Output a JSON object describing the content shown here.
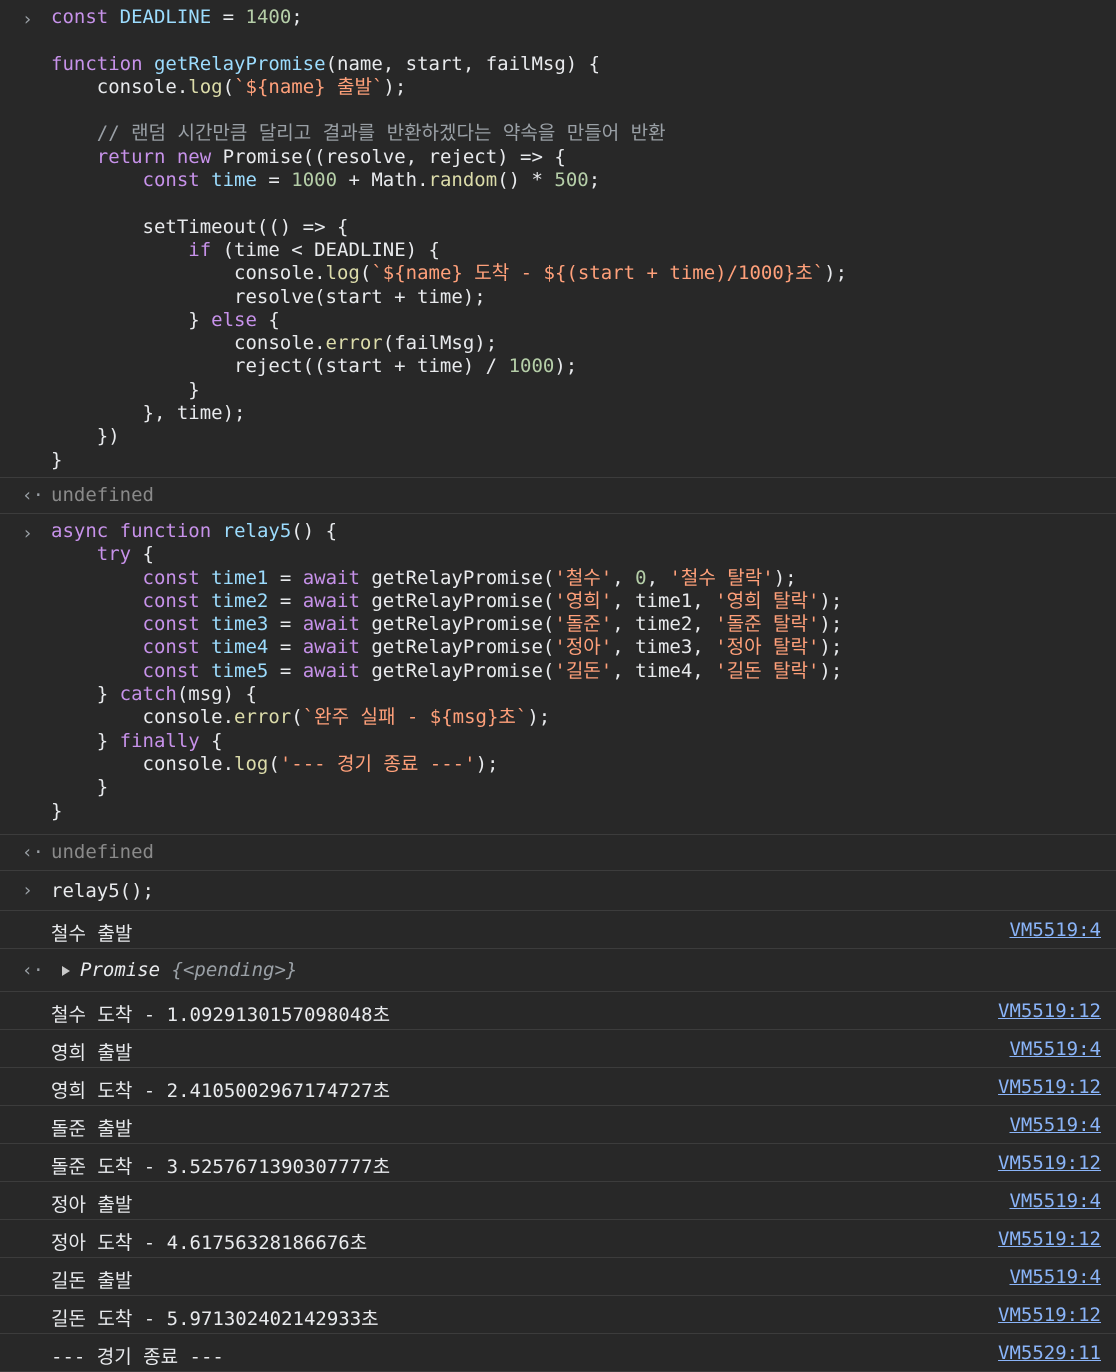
{
  "prompt_glyph": "›",
  "result_glyph": "‹·",
  "code_block_1": [
    "const DEADLINE = 1400;",
    "",
    "function getRelayPromise(name, start, failMsg) {",
    "    console.log(`${name} 출발`);",
    "",
    "    // 랜덤 시간만큼 달리고 결과를 반환하겠다는 약속을 만들어 반환",
    "    return new Promise((resolve, reject) => {",
    "        const time = 1000 + Math.random() * 500;",
    "",
    "        setTimeout(() => {",
    "            if (time < DEADLINE) {",
    "                console.log(`${name} 도착 - ${(start + time)/1000}초`);",
    "                resolve(start + time);",
    "            } else {",
    "                console.error(failMsg);",
    "                reject((start + time) / 1000);",
    "            }",
    "        }, time);",
    "    })",
    "}"
  ],
  "result_1": "undefined",
  "code_block_2": [
    "async function relay5() {",
    "    try {",
    "        const time1 = await getRelayPromise('철수', 0, '철수 탈락');",
    "        const time2 = await getRelayPromise('영희', time1, '영희 탈락');",
    "        const time3 = await getRelayPromise('돌준', time2, '돌준 탈락');",
    "        const time4 = await getRelayPromise('정아', time3, '정아 탈락');",
    "        const time5 = await getRelayPromise('길돈', time4, '길돈 탈락');",
    "    } catch(msg) {",
    "        console.error(`완주 실패 - ${msg}초`);",
    "    } finally {",
    "        console.log('--- 경기 종료 ---');",
    "    }",
    "}"
  ],
  "result_2": "undefined",
  "command_3": "relay5();",
  "first_log": {
    "text": "철수 출발",
    "source": "VM5519:4"
  },
  "promise_result": {
    "name": "Promise",
    "state": "{<pending>}"
  },
  "logs": [
    {
      "text": "철수 도착 - 1.0929130157098048초",
      "source": "VM5519:12"
    },
    {
      "text": "영희 출발",
      "source": "VM5519:4"
    },
    {
      "text": "영희 도착 - 2.4105002967174727초",
      "source": "VM5519:12"
    },
    {
      "text": "돌준 출발",
      "source": "VM5519:4"
    },
    {
      "text": "돌준 도착 - 3.5257671390307777초",
      "source": "VM5519:12"
    },
    {
      "text": "정아 출발",
      "source": "VM5519:4"
    },
    {
      "text": "정아 도착 - 4.61756328186676초",
      "source": "VM5519:12"
    },
    {
      "text": "길돈 출발",
      "source": "VM5519:4"
    },
    {
      "text": "길돈 도착 - 5.971302402142933초",
      "source": "VM5519:12"
    },
    {
      "text": "--- 경기 종료 ---",
      "source": "VM5529:11"
    }
  ]
}
